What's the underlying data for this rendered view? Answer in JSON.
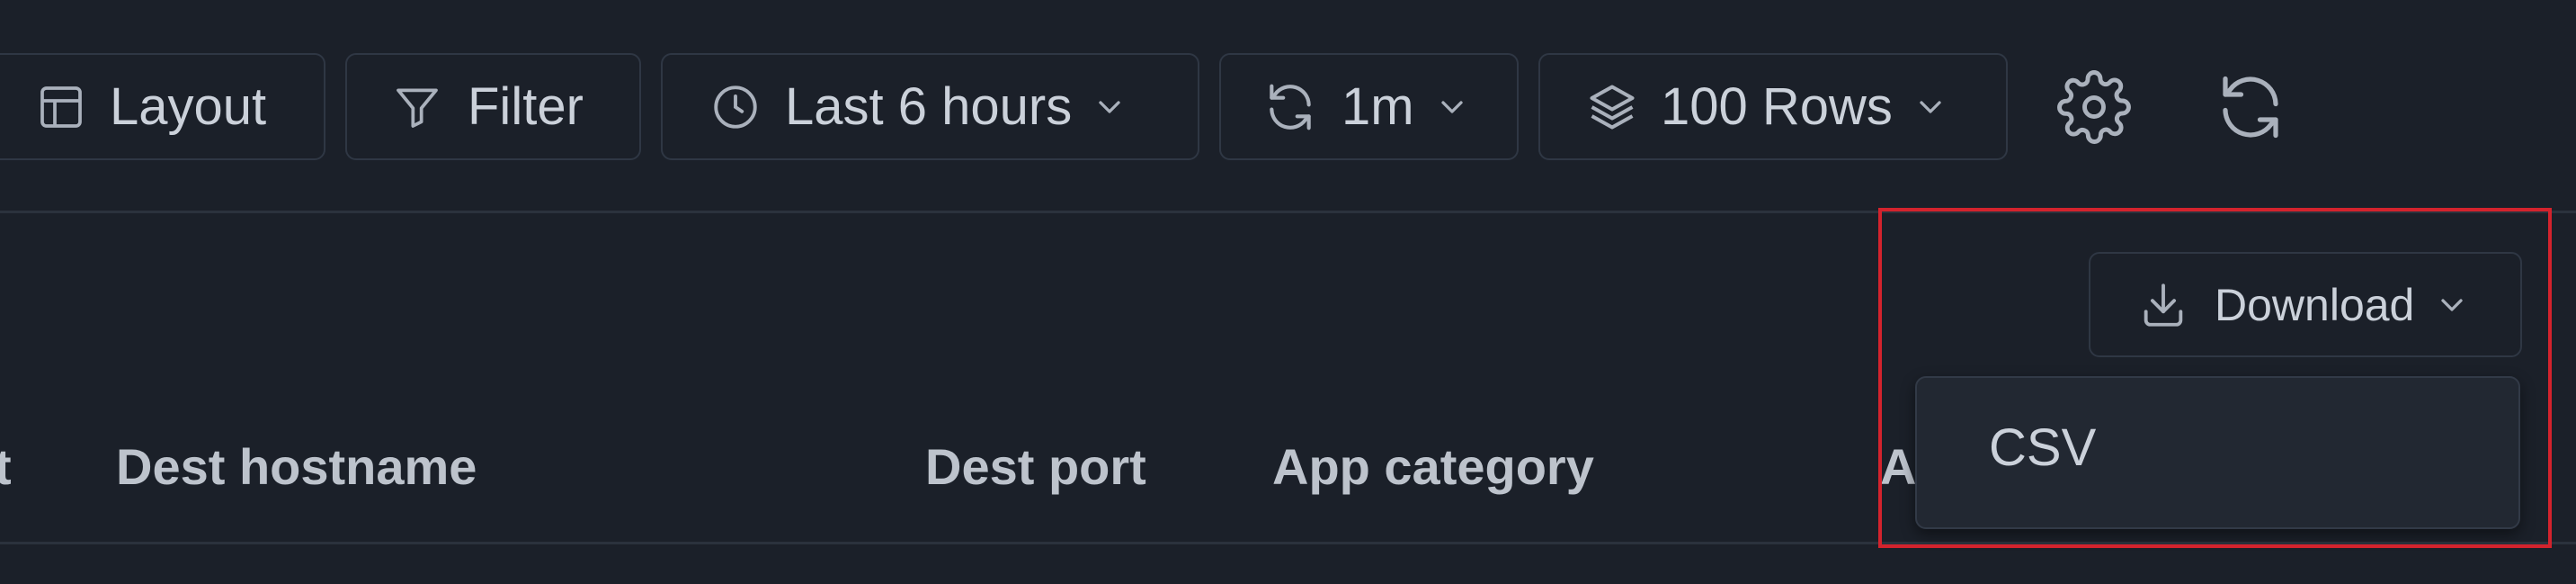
{
  "toolbar": {
    "layout_label": "Layout",
    "filter_label": "Filter",
    "time_range_label": "Last 6 hours",
    "refresh_interval_label": "1m",
    "rows_label": "100 Rows"
  },
  "download": {
    "label": "Download",
    "options": [
      "CSV"
    ]
  },
  "table": {
    "columns": [
      "t",
      "Dest hostname",
      "Dest port",
      "App category",
      "A"
    ]
  },
  "colors": {
    "background": "#1b2029",
    "border": "#2f3744",
    "text": "#cbd1da",
    "highlight": "#d3232d"
  }
}
